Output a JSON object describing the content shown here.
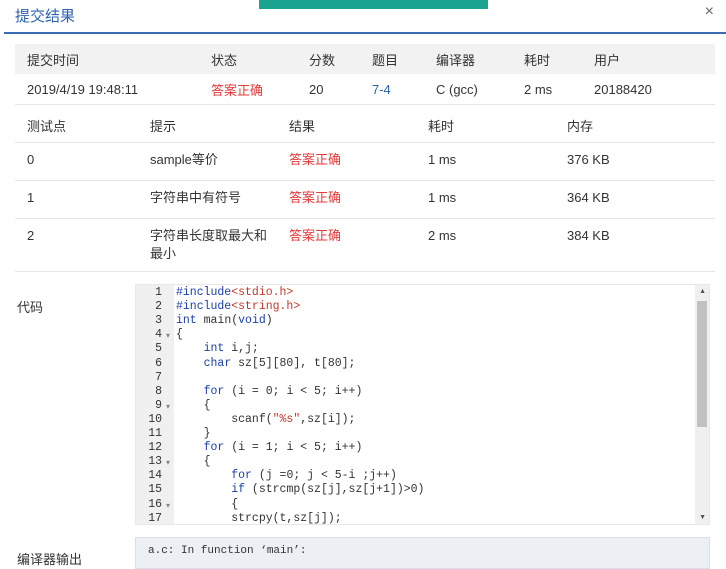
{
  "dialog": {
    "title": "提交结果",
    "close_glyph": "×"
  },
  "summary": {
    "headers": [
      "提交时间",
      "状态",
      "分数",
      "题目",
      "编译器",
      "耗时",
      "用户"
    ],
    "row": {
      "time": "2019/4/19 19:48:11",
      "status": "答案正确",
      "score": "20",
      "problem": "7-4",
      "compiler": "C (gcc)",
      "elapsed": "2 ms",
      "user": "20188420"
    }
  },
  "details": {
    "headers": [
      "测试点",
      "提示",
      "结果",
      "耗时",
      "内存"
    ],
    "rows": [
      {
        "id": "0",
        "hint": "sample等价",
        "result": "答案正确",
        "time": "1 ms",
        "memory": "376 KB"
      },
      {
        "id": "1",
        "hint": "字符串中有符号",
        "result": "答案正确",
        "time": "1 ms",
        "memory": "364 KB"
      },
      {
        "id": "2",
        "hint": "字符串长度取最大和最小",
        "result": "答案正确",
        "time": "2 ms",
        "memory": "384 KB"
      }
    ]
  },
  "code": {
    "label": "代码",
    "lines": [
      "#include<stdio.h>",
      "#include<string.h>",
      "int main(void)",
      "{",
      "    int i,j;",
      "    char sz[5][80], t[80];",
      "",
      "    for (i = 0; i < 5; i++)",
      "    {",
      "        scanf(\"%s\",sz[i]);",
      "    }",
      "    for (i = 1; i < 5; i++)",
      "    {",
      "        for (j =0; j < 5-i ;j++)",
      "        if (strcmp(sz[j],sz[j+1])>0)",
      "        {",
      "        strcpy(t,sz[j]);"
    ],
    "line_numbers": [
      "1",
      "2",
      "3",
      "4",
      "5",
      "6",
      "7",
      "8",
      "9",
      "10",
      "11",
      "12",
      "13",
      "14",
      "15",
      "16",
      "17"
    ]
  },
  "compiler_output": {
    "label": "编译器输出",
    "text": "a.c: In function ‘main’:"
  },
  "colors": {
    "accent": "#2d62b0",
    "ok": "#e4393c",
    "topbar": "#1aa38f"
  }
}
